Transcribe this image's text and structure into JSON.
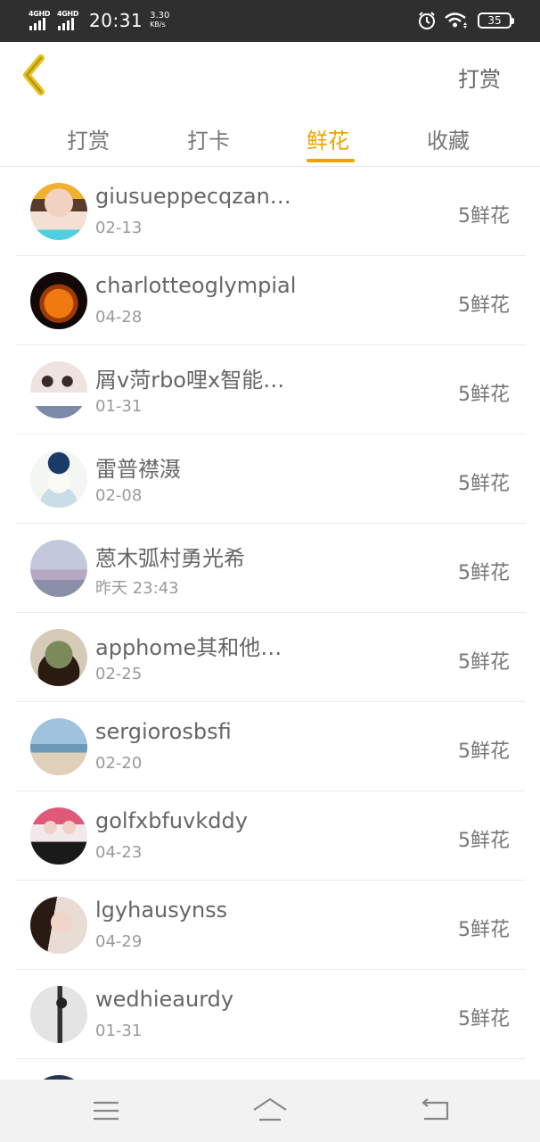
{
  "status_bar": {
    "network_1": "4GHD",
    "network_2": "4GHD",
    "time": "20:31",
    "speed_value": "3.30",
    "speed_unit": "KB/s",
    "battery": "35"
  },
  "header": {
    "action_label": "打赏"
  },
  "tabs": [
    {
      "label": "打赏"
    },
    {
      "label": "打卡"
    },
    {
      "label": "鲜花"
    },
    {
      "label": "收藏"
    }
  ],
  "active_tab": "鲜花",
  "accent_color": "#f0a300",
  "items": [
    {
      "name": "giusueppecqzan…",
      "date": "02-13",
      "amount": "5鲜花"
    },
    {
      "name": "charlotteoglympial",
      "date": "04-28",
      "amount": "5鲜花"
    },
    {
      "name": "屑v菏rbo哩x智能…",
      "date": "01-31",
      "amount": "5鲜花"
    },
    {
      "name": "雷普襟滠",
      "date": "02-08",
      "amount": "5鲜花"
    },
    {
      "name": "蒽木弧村勇光希",
      "date": "昨天 23:43",
      "amount": "5鲜花"
    },
    {
      "name": "apphome其和他…",
      "date": "02-25",
      "amount": "5鲜花"
    },
    {
      "name": "sergiorosbsfi",
      "date": "02-20",
      "amount": "5鲜花"
    },
    {
      "name": "golfxbfuvkddy",
      "date": "04-23",
      "amount": "5鲜花"
    },
    {
      "name": "lgyhausynss",
      "date": "04-29",
      "amount": "5鲜花"
    },
    {
      "name": "wedhieaurdy",
      "date": "01-31",
      "amount": "5鲜花"
    }
  ]
}
